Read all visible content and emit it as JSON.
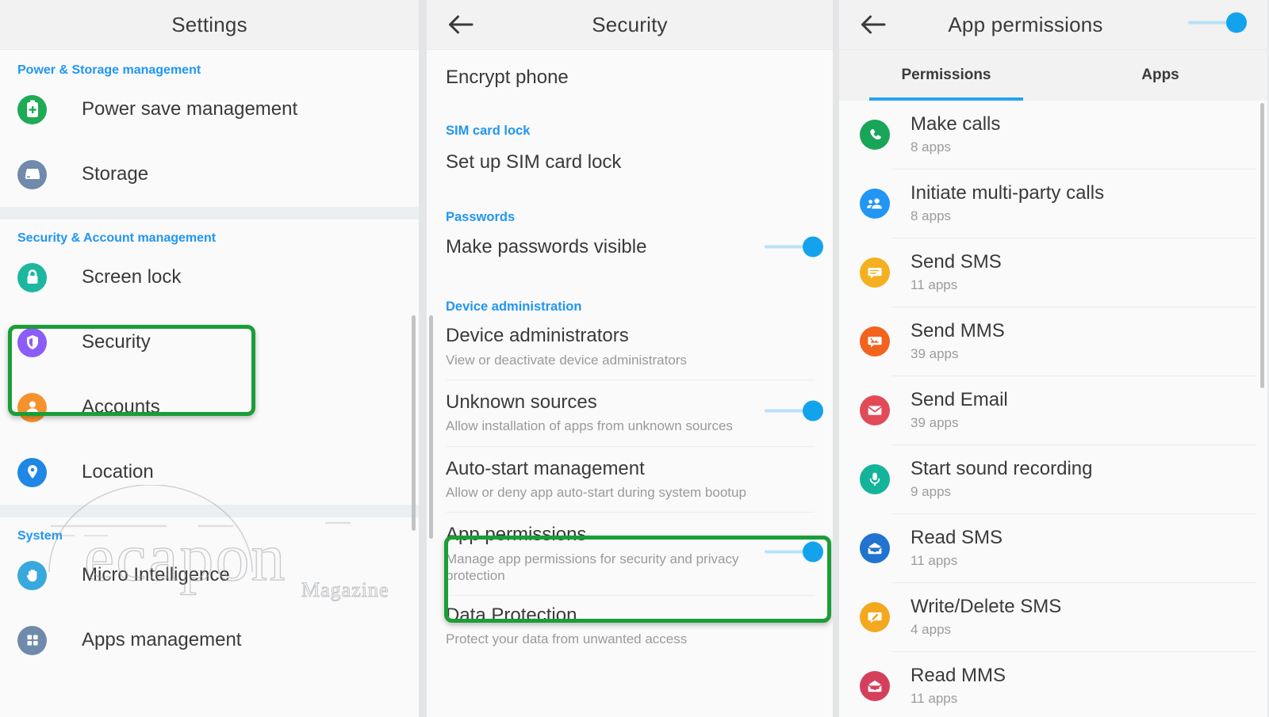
{
  "colors": {
    "accent_blue": "#2196f3",
    "toggle_on": "#13a3ec",
    "highlight_green": "#1a9e37",
    "tab_underline": "#26a3ef"
  },
  "panel_settings": {
    "title": "Settings",
    "sections": [
      {
        "label": "Power & Storage management",
        "items": [
          {
            "label": "Power save management",
            "icon": "battery-plus-icon",
            "icon_color": "#1faa55"
          },
          {
            "label": "Storage",
            "icon": "storage-disk-icon",
            "icon_color": "#6f8aab"
          }
        ]
      },
      {
        "label": "Security & Account management",
        "items": [
          {
            "label": "Screen lock",
            "icon": "padlock-icon",
            "icon_color": "#1bb7a1"
          },
          {
            "label": "Security",
            "icon": "shield-icon",
            "icon_color": "#8b5cf6"
          },
          {
            "label": "Accounts",
            "icon": "person-icon",
            "icon_color": "#f5922d"
          },
          {
            "label": "Location",
            "icon": "location-pin-icon",
            "icon_color": "#1f87e5"
          }
        ]
      },
      {
        "label": "System",
        "items": [
          {
            "label": "Micro Intelligence",
            "icon": "hand-icon",
            "icon_color": "#39a8dd"
          },
          {
            "label": "Apps management",
            "icon": "grid-apps-icon",
            "icon_color": "#6f8aab"
          }
        ]
      }
    ],
    "highlighted_item": "Security"
  },
  "panel_security": {
    "title": "Security",
    "back_icon": "arrow-left-icon",
    "rows": [
      {
        "title": "Encrypt phone",
        "subtitle": "",
        "toggle": null
      },
      {
        "section": "SIM card lock"
      },
      {
        "title": "Set up SIM card lock",
        "subtitle": "",
        "toggle": null
      },
      {
        "section": "Passwords"
      },
      {
        "title": "Make passwords visible",
        "subtitle": "",
        "toggle": "on"
      },
      {
        "section": "Device administration"
      },
      {
        "title": "Device administrators",
        "subtitle": "View or deactivate device administrators",
        "toggle": null
      },
      {
        "title": "Unknown sources",
        "subtitle": "Allow installation of apps from unknown sources",
        "toggle": "on"
      },
      {
        "title": "Auto-start management",
        "subtitle": "Allow or deny app auto-start during system bootup",
        "toggle": null
      },
      {
        "title": "App permissions",
        "subtitle": "Manage app permissions for security and privacy protection",
        "toggle": "on"
      },
      {
        "title": "Data Protection",
        "subtitle": "Protect your data from unwanted access",
        "toggle": null
      }
    ],
    "highlighted_item": "App permissions"
  },
  "panel_app_permissions": {
    "title": "App permissions",
    "back_icon": "arrow-left-icon",
    "header_toggle": "on",
    "tabs": [
      {
        "label": "Permissions",
        "active": true
      },
      {
        "label": "Apps",
        "active": false
      }
    ],
    "permissions": [
      {
        "name": "Make calls",
        "count": "8 apps",
        "icon": "phone-icon",
        "icon_color": "#19a558"
      },
      {
        "name": "Initiate multi-party calls",
        "count": "8 apps",
        "icon": "group-call-icon",
        "icon_color": "#2196f3"
      },
      {
        "name": "Send SMS",
        "count": "11 apps",
        "icon": "chat-bubble-icon",
        "icon_color": "#f4b01e"
      },
      {
        "name": "Send MMS",
        "count": "39 apps",
        "icon": "image-message-icon",
        "icon_color": "#f2631e"
      },
      {
        "name": "Send Email",
        "count": "39 apps",
        "icon": "envelope-icon",
        "icon_color": "#e14b57"
      },
      {
        "name": "Start sound recording",
        "count": "9 apps",
        "icon": "microphone-icon",
        "icon_color": "#13b49a"
      },
      {
        "name": "Read SMS",
        "count": "11 apps",
        "icon": "open-envelope-icon",
        "icon_color": "#2073cf"
      },
      {
        "name": "Write/Delete SMS",
        "count": "4 apps",
        "icon": "pencil-message-icon",
        "icon_color": "#f4a81e"
      },
      {
        "name": "Read MMS",
        "count": "11 apps",
        "icon": "read-mms-icon",
        "icon_color": "#d4405b"
      }
    ]
  },
  "watermark": {
    "text": "ecapon",
    "subtext": "Magazine"
  }
}
